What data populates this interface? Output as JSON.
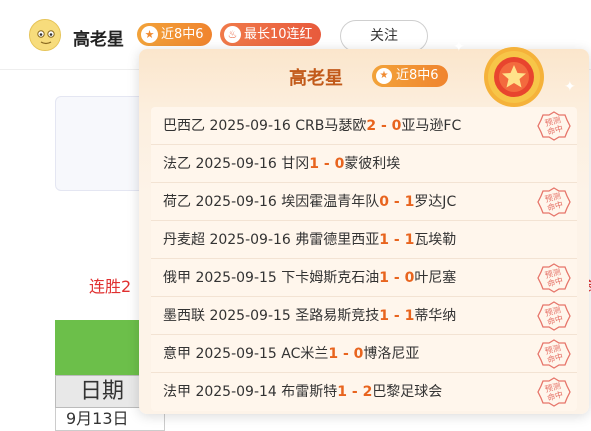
{
  "header": {
    "username": "高老星",
    "streak_badge": "近8中6",
    "best_badge": "最长10连红",
    "follow_label": "关注"
  },
  "background": {
    "red_text": "连胜2",
    "right_fragment": "参",
    "table_header": "日期",
    "table_row": "9月13日"
  },
  "popup": {
    "title": "高老星",
    "badge": "近8中6",
    "stamp_text": "预测命中",
    "matches": [
      {
        "league": "巴西乙",
        "date": "2025-09-16",
        "home": "CRB马瑟欧",
        "score": "2 - 0",
        "away": "亚马逊FC",
        "hit": true
      },
      {
        "league": "法乙",
        "date": "2025-09-16",
        "home": "甘冈",
        "score": "1 - 0",
        "away": "蒙彼利埃",
        "hit": false
      },
      {
        "league": "荷乙",
        "date": "2025-09-16",
        "home": "埃因霍温青年队",
        "score": "0 - 1",
        "away": "罗达JC",
        "hit": true
      },
      {
        "league": "丹麦超",
        "date": "2025-09-16",
        "home": "弗雷德里西亚",
        "score": "1 - 1",
        "away": "瓦埃勒",
        "hit": false
      },
      {
        "league": "俄甲",
        "date": "2025-09-15",
        "home": "下卡姆斯克石油",
        "score": "1 - 0",
        "away": "叶尼塞",
        "hit": true
      },
      {
        "league": "墨西联",
        "date": "2025-09-15",
        "home": "圣路易斯竞技",
        "score": "1 - 1",
        "away": "蒂华纳",
        "hit": true
      },
      {
        "league": "意甲",
        "date": "2025-09-15",
        "home": "AC米兰",
        "score": "1 - 0",
        "away": "博洛尼亚",
        "hit": true
      },
      {
        "league": "法甲",
        "date": "2025-09-14",
        "home": "布雷斯特",
        "score": "1 - 2",
        "away": "巴黎足球会",
        "hit": true
      }
    ]
  },
  "colors": {
    "accent_orange": "#f0842e",
    "score_orange": "#e8641e",
    "stamp_red": "#e0554a"
  }
}
